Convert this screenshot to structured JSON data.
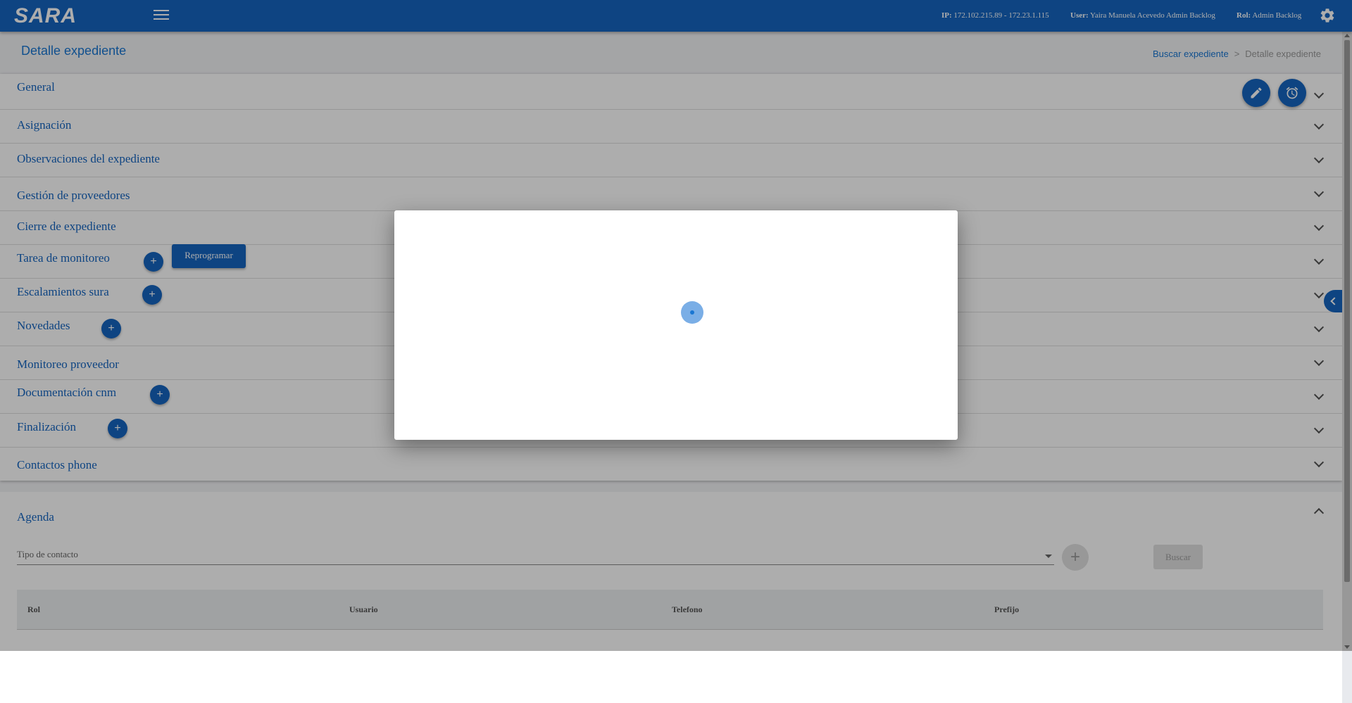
{
  "topbar": {
    "logo": "SARA",
    "ip_label": "IP:",
    "ip_value": "172.102.215.89 - 172.23.1.115",
    "user_label": "User:",
    "user_value": "Yaira Manuela Acevedo Admin Backlog",
    "rol_label": "Rol:",
    "rol_value": "Admin Backlog"
  },
  "page": {
    "title": "Detalle expediente",
    "breadcrumb": {
      "link": "Buscar expediente",
      "separator": ">",
      "current": "Detalle expediente"
    }
  },
  "panels": [
    {
      "label": "General"
    },
    {
      "label": "Asignación"
    },
    {
      "label": "Observaciones del expediente"
    },
    {
      "label": "Gestión de proveedores"
    },
    {
      "label": "Cierre de expediente"
    },
    {
      "label": "Tarea de monitoreo"
    },
    {
      "label": "Escalamientos sura"
    },
    {
      "label": "Novedades"
    },
    {
      "label": "Monitoreo proveedor"
    },
    {
      "label": "Documentación cnm"
    },
    {
      "label": "Finalización"
    },
    {
      "label": "Contactos phone"
    }
  ],
  "buttons": {
    "plus": "+",
    "reprogramar": "Reprogramar"
  },
  "agenda": {
    "title": "Agenda",
    "tipo_contacto_label": "Tipo de contacto",
    "add": "+",
    "buscar": "Buscar",
    "columns": [
      "Rol",
      "Usuario",
      "Telefono",
      "Prefijo"
    ]
  },
  "colors": {
    "primary": "#1565c0",
    "accent": "#1976d2"
  }
}
